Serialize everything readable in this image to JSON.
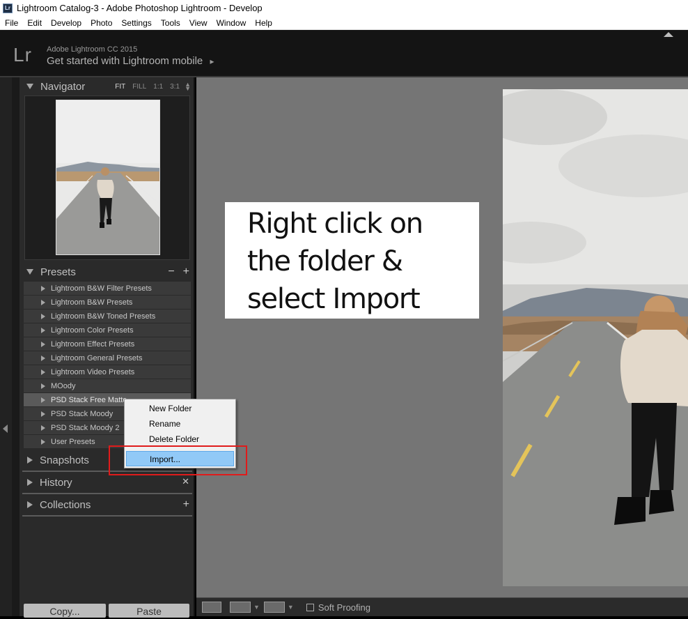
{
  "window": {
    "title": "Lightroom Catalog-3 - Adobe Photoshop Lightroom - Develop",
    "icon_text": "Lr"
  },
  "menu": [
    "File",
    "Edit",
    "Develop",
    "Photo",
    "Settings",
    "Tools",
    "View",
    "Window",
    "Help"
  ],
  "identity_plate": {
    "logo": "Lr",
    "product": "Adobe Lightroom CC 2015",
    "mobile_link": "Get started with Lightroom mobile",
    "mobile_arrow": "▸"
  },
  "navigator": {
    "title": "Navigator",
    "options": [
      "FIT",
      "FILL",
      "1:1",
      "3:1"
    ],
    "active_option": "FIT"
  },
  "presets": {
    "title": "Presets",
    "remove_icon": "−",
    "add_icon": "+",
    "items": [
      "Lightroom B&W Filter Presets",
      "Lightroom B&W Presets",
      "Lightroom B&W Toned Presets",
      "Lightroom Color Presets",
      "Lightroom Effect Presets",
      "Lightroom General Presets",
      "Lightroom Video Presets",
      "MOody",
      "PSD Stack Free Matte",
      "PSD Stack Moody",
      "PSD Stack Moody 2",
      "User Presets"
    ],
    "selected_index": 8
  },
  "panels": {
    "snapshots": "Snapshots",
    "history": "History",
    "history_clear_icon": "✕",
    "collections": "Collections",
    "collections_add_icon": "+"
  },
  "bottom_buttons": {
    "copy": "Copy...",
    "paste": "Paste"
  },
  "toolbar": {
    "soft_proofing": "Soft Proofing"
  },
  "context_menu": {
    "items": [
      "New Folder",
      "Rename",
      "Delete Folder",
      "Import..."
    ],
    "highlighted": "Import..."
  },
  "callout": {
    "lines": [
      "Right click on",
      "the folder &",
      "select Import"
    ]
  },
  "colors": {
    "highlight": "#91c9f7",
    "annotation_red": "#e01b1b",
    "panel_bg": "#2a2a2a",
    "main_bg": "#757575"
  }
}
